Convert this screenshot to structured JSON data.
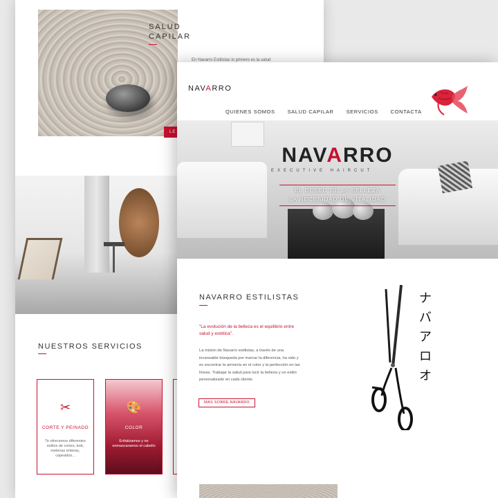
{
  "back_page": {
    "salud": {
      "title_line1": "SALUD",
      "title_line2": "CAPILAR",
      "intro": "En Navarro Estilistas lo primero es la salud",
      "button_label": "LE"
    },
    "services": {
      "title": "NUESTROS SERVICIOS",
      "cards": [
        {
          "icon": "scissors-icon",
          "glyph": "✂",
          "title": "CORTE Y PEINADO",
          "text": "Te ofrecemos diferentes estilos de cortes, bob, melenas enteras, capeados..."
        },
        {
          "icon": "palette-icon",
          "glyph": "🎨",
          "title": "COLOR",
          "text": "Enfatizamos y no enmascaramos el cabello"
        }
      ]
    }
  },
  "front_page": {
    "logo": {
      "part1": "NAV",
      "part2": "A",
      "part3": "RRO"
    },
    "nav": [
      "QUIENES SOMOS",
      "SALUD CAPILAR",
      "SERVICIOS",
      "CONTACTA"
    ],
    "hero": {
      "brand_1": "NAV",
      "brand_2": "A",
      "brand_3": "RRO",
      "subtitle": "EXECUTIVE HAIRCUT",
      "tagline_1": "EL DESEO DE LA BELLEZA",
      "tagline_2": "LA NECESIDAD DE VITALIDAD"
    },
    "about": {
      "title": "NAVARRO ESTILISTAS",
      "quote": "\"La evolución de la belleza es el equilibrio entre salud y estética\".",
      "text": "La misión de Navarro estilistas, a través de una incansable búsqueda por marcar la diferencia, ha sido y es encontrar la armonía en el color y la perfección en las líneas. Trabajar la salud para lucir la belleza y un estilo personalizado en cada cliente.",
      "button_label": "MAS SOBRE NAVARRO"
    },
    "kanji": [
      "ナ",
      "バ",
      "ア",
      "ロ",
      "オ"
    ],
    "colors": {
      "accent": "#c8102e",
      "text": "#333333"
    }
  }
}
